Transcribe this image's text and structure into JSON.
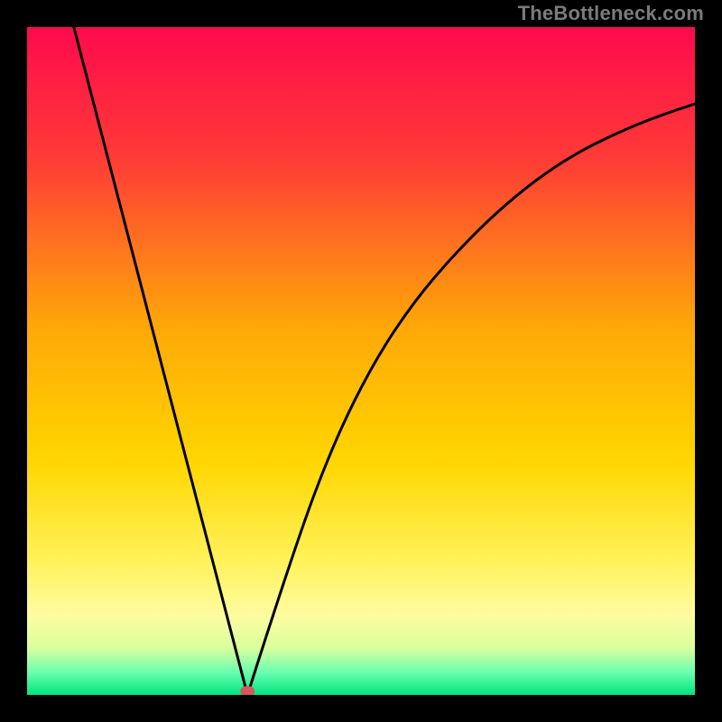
{
  "watermark": "TheBottleneck.com",
  "chart_data": {
    "type": "line",
    "title": "",
    "xlabel": "",
    "ylabel": "",
    "xlim": [
      0,
      100
    ],
    "ylim": [
      0,
      100
    ],
    "grid": false,
    "legend": false,
    "optimum_point_x": 33,
    "background_gradient": {
      "stops": [
        {
          "pos": 0.0,
          "color": "#ff0a4d"
        },
        {
          "pos": 0.2,
          "color": "#ff3c36"
        },
        {
          "pos": 0.45,
          "color": "#ffa808"
        },
        {
          "pos": 0.65,
          "color": "#ffd600"
        },
        {
          "pos": 0.8,
          "color": "#fff25a"
        },
        {
          "pos": 0.88,
          "color": "#fffca0"
        },
        {
          "pos": 0.93,
          "color": "#d9ff9e"
        },
        {
          "pos": 0.965,
          "color": "#6dffb0"
        },
        {
          "pos": 1.0,
          "color": "#00e57f"
        }
      ]
    },
    "series": [
      {
        "name": "left-branch",
        "x": [
          7,
          33
        ],
        "y": [
          100,
          0
        ],
        "shape": "straight"
      },
      {
        "name": "right-branch",
        "x": [
          33,
          40,
          46,
          52,
          58,
          64,
          70,
          76,
          82,
          88,
          94,
          100
        ],
        "y": [
          0,
          22,
          38,
          50,
          59,
          66,
          72,
          77,
          81,
          84,
          86.5,
          88.5
        ],
        "shape": "concave"
      }
    ],
    "marker": {
      "x": 33,
      "y": 0,
      "color": "#d15a5a"
    }
  }
}
